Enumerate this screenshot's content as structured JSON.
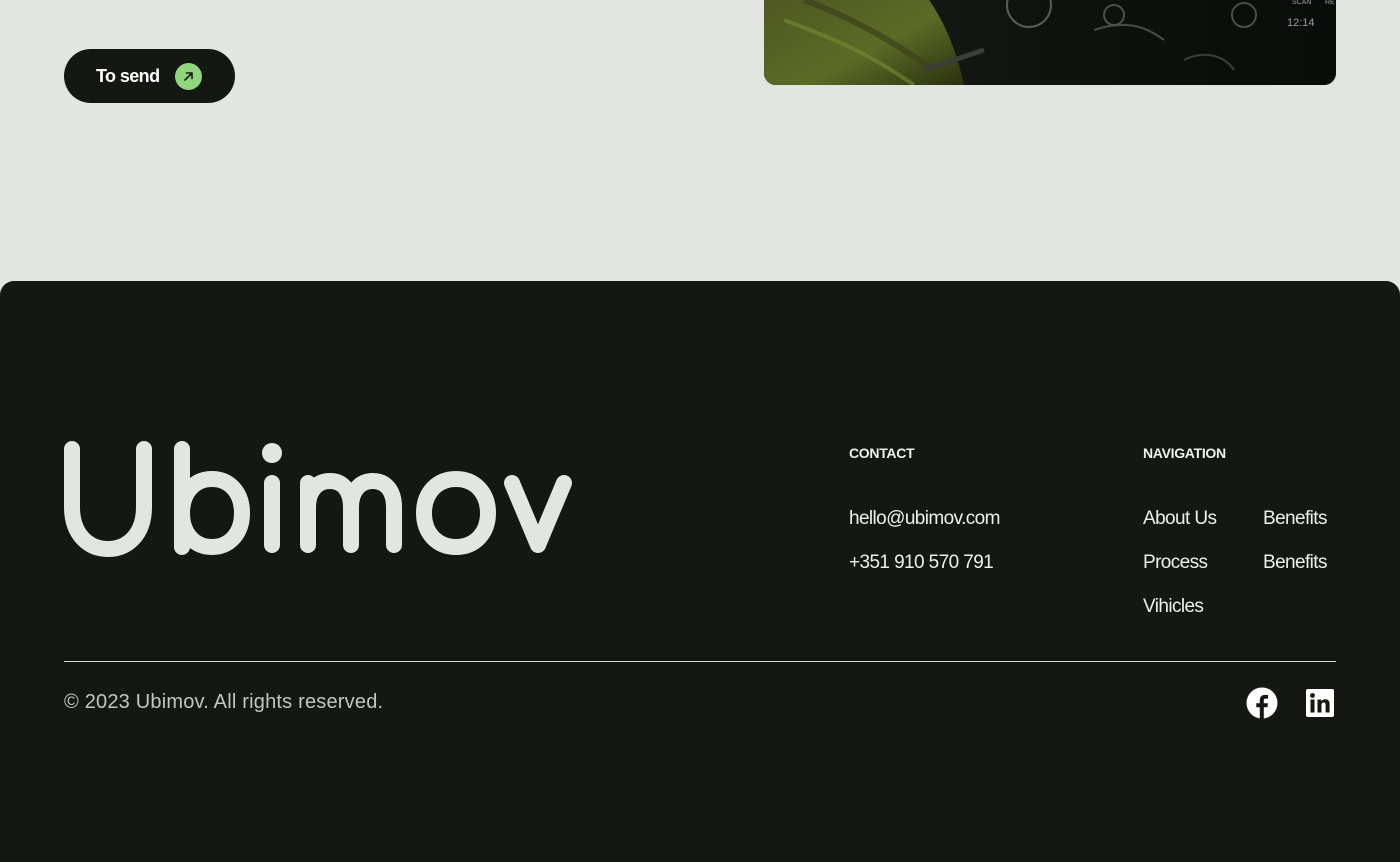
{
  "cta": {
    "send_label": "To send",
    "accent": "#8fd67c"
  },
  "footer": {
    "logo_text": "Ubimov",
    "contact": {
      "heading": "CONTACT",
      "email": "hello@ubimov.com",
      "phone": "+351 910 570 791"
    },
    "navigation": {
      "heading": "NAVIGATION",
      "items": [
        "About Us",
        "Benefits",
        "Process",
        "Benefits",
        "Vihicles"
      ]
    },
    "copyright": "© 2023 Ubimov. All rights reserved.",
    "social": [
      "facebook-icon",
      "linkedin-icon"
    ]
  },
  "colors": {
    "page_bg": "#e3e6e0",
    "footer_bg": "#151812",
    "footer_text": "#eef0ea"
  }
}
